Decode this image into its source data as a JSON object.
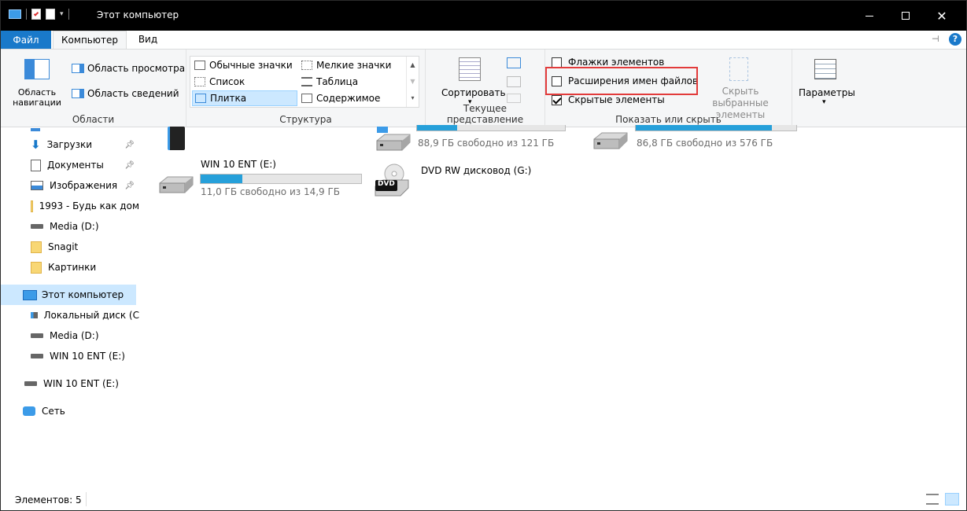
{
  "window": {
    "title": "Этот компьютер"
  },
  "menu": {
    "file": "Файл",
    "tabs": [
      "Компьютер",
      "Вид"
    ]
  },
  "ribbon": {
    "panes": {
      "nav_pane": "Область навигации",
      "preview": "Область просмотра",
      "details": "Область сведений",
      "group_label": "Области"
    },
    "layout": {
      "items": [
        "Обычные значки",
        "Мелкие значки",
        "Список",
        "Таблица",
        "Плитка",
        "Содержимое"
      ],
      "selected": "Плитка",
      "group_label": "Структура"
    },
    "current_view": {
      "sort": "Сортировать",
      "group_label": "Текущее представление"
    },
    "show_hide": {
      "checkboxes": [
        {
          "label": "Флажки элементов",
          "checked": false
        },
        {
          "label": "Расширения имен файлов",
          "checked": false
        },
        {
          "label": "Скрытые элементы",
          "checked": true
        }
      ],
      "hide_selected": "Скрыть выбранные элементы",
      "group_label": "Показать или скрыть"
    },
    "options": {
      "label": "Параметры"
    }
  },
  "nav": {
    "items": [
      {
        "label": "Загрузки",
        "icon": "download-arrow-icon",
        "pinned": true
      },
      {
        "label": "Документы",
        "icon": "documents-icon",
        "pinned": true
      },
      {
        "label": "Изображения",
        "icon": "pictures-icon",
        "pinned": true
      },
      {
        "label": "1993 - Будь как дом",
        "icon": "folder-icon",
        "pinned": false
      },
      {
        "label": "Media (D:)",
        "icon": "drive-icon",
        "pinned": false
      },
      {
        "label": "Snagit",
        "icon": "folder-icon",
        "pinned": false
      },
      {
        "label": "Картинки",
        "icon": "folder-icon",
        "pinned": false
      },
      {
        "label": "Этот компьютер",
        "icon": "computer-icon",
        "pinned": false
      },
      {
        "label": "Локальный диск (C",
        "icon": "system-drive-icon",
        "pinned": false
      },
      {
        "label": "Media (D:)",
        "icon": "drive-icon",
        "pinned": false
      },
      {
        "label": "WIN 10 ENT (E:)",
        "icon": "drive-icon",
        "pinned": false
      },
      {
        "label": "WIN 10 ENT (E:)",
        "icon": "drive-icon",
        "pinned": false
      },
      {
        "label": "Сеть",
        "icon": "network-icon",
        "pinned": false
      }
    ],
    "selected": "Этот компьютер"
  },
  "drives": [
    {
      "name": "",
      "free": "88,9 ГБ свободно из 121 ГБ",
      "used_fraction": 0.27
    },
    {
      "name": "",
      "free": "86,8 ГБ свободно из 576 ГБ",
      "used_fraction": 0.85
    },
    {
      "name": "WIN 10 ENT (E:)",
      "free": "11,0 ГБ свободно из 14,9 ГБ",
      "used_fraction": 0.26
    },
    {
      "name": "DVD RW дисковод (G:)",
      "free": "",
      "used_fraction": null
    }
  ],
  "dvd_badge": "DVD",
  "status": {
    "items": "Элементов: 5"
  }
}
